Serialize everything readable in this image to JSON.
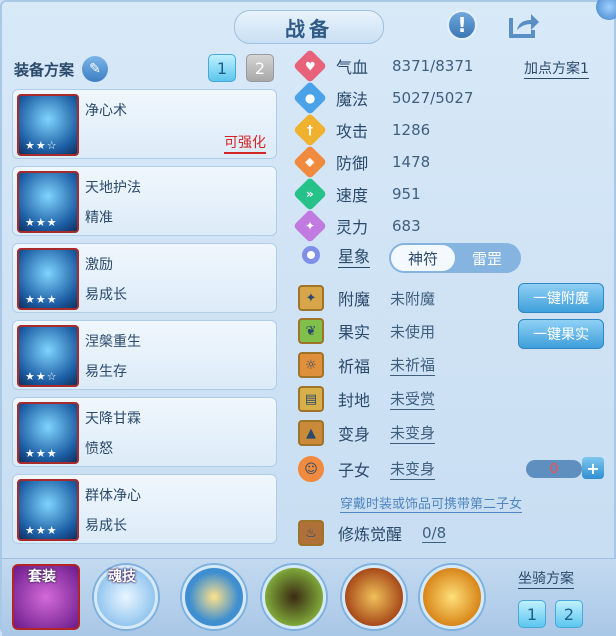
{
  "title": "战备",
  "equip_plan": {
    "label": "装备方案",
    "tabs": [
      "1",
      "2"
    ]
  },
  "skills": [
    {
      "name": "净心术",
      "sub": "",
      "stars": "★★☆",
      "enhance": "可强化"
    },
    {
      "name": "天地护法",
      "sub": "精准",
      "stars": "★★★",
      "enhance": ""
    },
    {
      "name": "激励",
      "sub": "易成长",
      "stars": "★★★",
      "enhance": ""
    },
    {
      "name": "涅槃重生",
      "sub": "易生存",
      "stars": "★★☆",
      "enhance": ""
    },
    {
      "name": "天降甘霖",
      "sub": "愤怒",
      "stars": "★★★",
      "enhance": ""
    },
    {
      "name": "群体净心",
      "sub": "易成长",
      "stars": "★★★",
      "enhance": ""
    }
  ],
  "stats": [
    {
      "label": "气血",
      "value": "8371/8371",
      "icon": "heart-icon",
      "color": "#e8627a"
    },
    {
      "label": "魔法",
      "value": "5027/5027",
      "icon": "mana-icon",
      "color": "#4aa3e8"
    },
    {
      "label": "攻击",
      "value": "1286",
      "icon": "attack-icon",
      "color": "#f0b22e"
    },
    {
      "label": "防御",
      "value": "1478",
      "icon": "defense-icon",
      "color": "#f08a3e"
    },
    {
      "label": "速度",
      "value": "951",
      "icon": "speed-icon",
      "color": "#27c28a"
    },
    {
      "label": "灵力",
      "value": "683",
      "icon": "spirit-icon",
      "color": "#c07ae0"
    }
  ],
  "add_point_plan": "加点方案1",
  "star_sign": {
    "label": "星象",
    "options": [
      "神符",
      "雷罡"
    ],
    "selected": "神符"
  },
  "features": [
    {
      "label": "附魔",
      "value": "未附魔",
      "underline": false
    },
    {
      "label": "果实",
      "value": "未使用",
      "underline": false
    },
    {
      "label": "祈福",
      "value": "未祈福",
      "underline": true
    },
    {
      "label": "封地",
      "value": "未受赏",
      "underline": true
    },
    {
      "label": "变身",
      "value": "未变身",
      "underline": true
    },
    {
      "label": "子女",
      "value": "未变身",
      "underline": true
    },
    {
      "label": "修炼觉醒",
      "value": "0/8",
      "underline": true
    }
  ],
  "buttons": {
    "enchant": "一键附魔",
    "fruit": "一键果实"
  },
  "child_count": "0",
  "hint": "穿戴时装或饰品可携带第二子女",
  "bottom": {
    "suit": "套装",
    "soul_skill": "魂技",
    "mount_plan": "坐骑方案",
    "mount_tabs": [
      "1",
      "2"
    ]
  }
}
